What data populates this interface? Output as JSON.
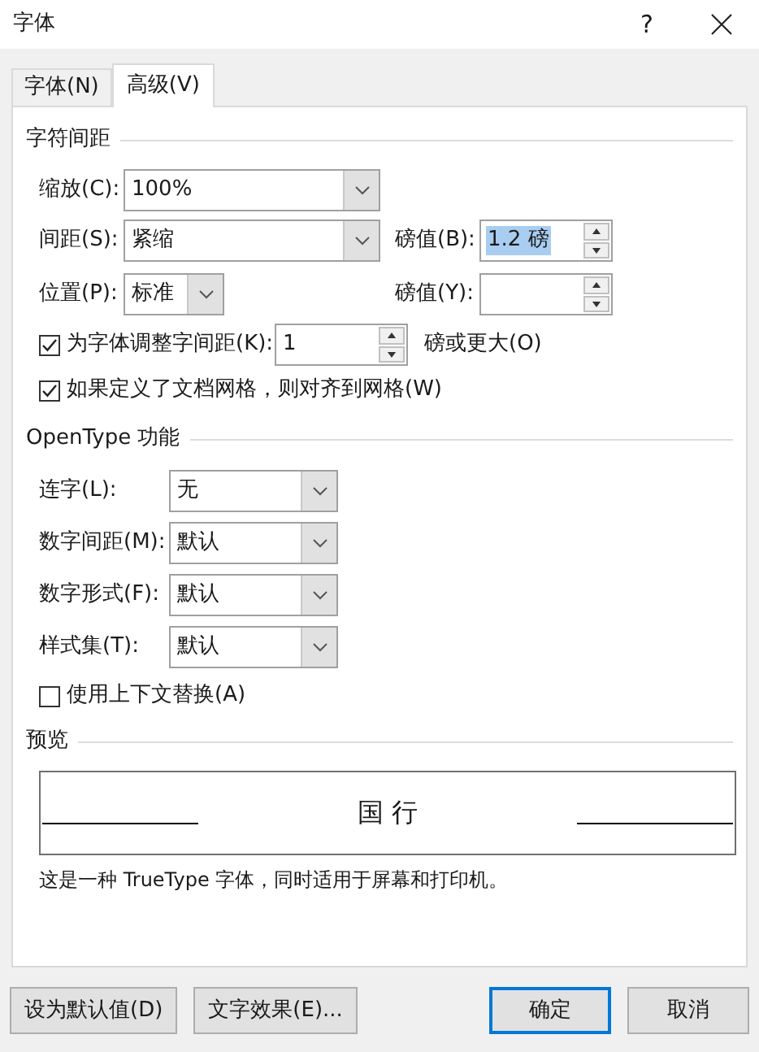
{
  "window": {
    "title": "字体",
    "help": "?"
  },
  "tabs": [
    {
      "label": "字体(N)",
      "selected": false
    },
    {
      "label": "高级(V)",
      "selected": true
    }
  ],
  "character_spacing": {
    "title": "字符间距",
    "scale": {
      "label": "缩放(C):",
      "value": "100%"
    },
    "spacing": {
      "label": "间距(S):",
      "value": "紧缩",
      "by_label": "磅值(B):",
      "by_value": "1.2 磅",
      "by_value_selected": true
    },
    "position": {
      "label": "位置(P):",
      "value": "标准",
      "by_label": "磅值(Y):"
    },
    "kerning": {
      "label": "为字体调整字间距(K):",
      "checked": true,
      "value": "1",
      "suffix": "磅或更大(O)"
    },
    "snap_to_grid": {
      "label": "如果定义了文档网格，则对齐到网格(W)",
      "checked": true
    }
  },
  "opentype": {
    "title": "OpenType 功能",
    "options": [
      {
        "label": "连字(L):",
        "value": "无"
      },
      {
        "label": "数字间距(M):",
        "value": "默认"
      },
      {
        "label": "数字形式(F):",
        "value": "默认"
      },
      {
        "label": "样式集(T):",
        "value": "默认"
      }
    ],
    "contextual_alternates": {
      "label": "使用上下文替换(A)",
      "checked": false
    }
  },
  "preview": {
    "title": "预览",
    "sample": "国 行",
    "description": "这是一种 TrueType 字体，同时适用于屏幕和打印机。"
  },
  "left_buttons": [
    {
      "label": "设为默认值(D)",
      "default": false
    },
    {
      "label": "文字效果(E)...",
      "default": false
    }
  ],
  "right_buttons": [
    {
      "label": "确定",
      "default": true
    },
    {
      "label": "取消",
      "default": false
    }
  ]
}
